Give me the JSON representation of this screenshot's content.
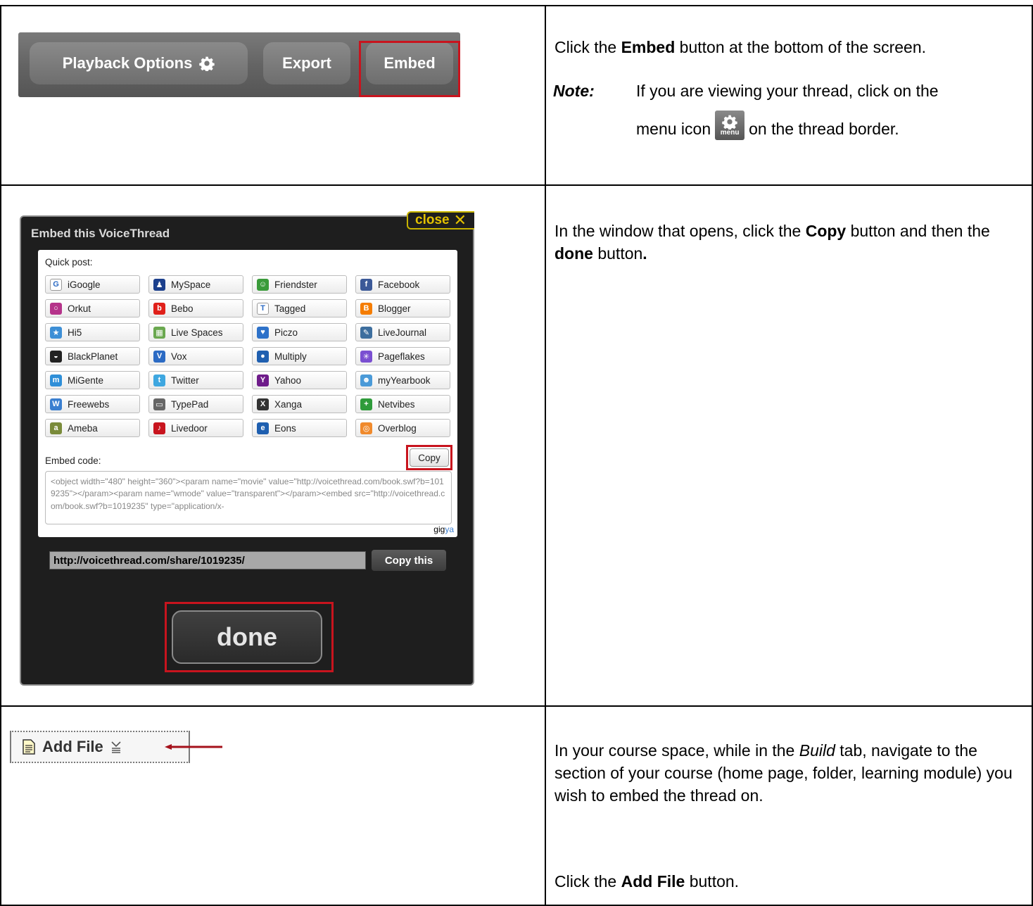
{
  "row1": {
    "toolbar": {
      "playback_label": "Playback Options",
      "export_label": "Export",
      "embed_label": "Embed"
    },
    "instruction": {
      "pre": "Click the ",
      "bold": "Embed",
      "post": " button at the bottom of the screen."
    },
    "note": {
      "label": "Note:",
      "text_pre": "If you are viewing your thread, click on the",
      "text_mid": "menu icon",
      "text_post": "on the thread border.",
      "menu_icon_label": "menu"
    }
  },
  "row2": {
    "dialog": {
      "title": "Embed this VoiceThread",
      "close_label": "close",
      "quick_post_label": "Quick post:",
      "services": [
        {
          "name": "iGoogle",
          "icon": "google-icon",
          "color": "#ffffff"
        },
        {
          "name": "MySpace",
          "icon": "myspace-icon",
          "color": "#1b3f8c"
        },
        {
          "name": "Friendster",
          "icon": "friendster-icon",
          "color": "#3a9b3a"
        },
        {
          "name": "Facebook",
          "icon": "facebook-icon",
          "color": "#3b5998"
        },
        {
          "name": "Orkut",
          "icon": "orkut-icon",
          "color": "#b5338a"
        },
        {
          "name": "Bebo",
          "icon": "bebo-icon",
          "color": "#e0201a"
        },
        {
          "name": "Tagged",
          "icon": "tagged-icon",
          "color": "#ffffff"
        },
        {
          "name": "Blogger",
          "icon": "blogger-icon",
          "color": "#f57d00"
        },
        {
          "name": "Hi5",
          "icon": "hi5-icon",
          "color": "#3d8fd6"
        },
        {
          "name": "Live Spaces",
          "icon": "livespaces-icon",
          "color": "#6aa84f"
        },
        {
          "name": "Piczo",
          "icon": "piczo-icon",
          "color": "#2e72c9"
        },
        {
          "name": "LiveJournal",
          "icon": "livejournal-icon",
          "color": "#3d6e9e"
        },
        {
          "name": "BlackPlanet",
          "icon": "blackplanet-icon",
          "color": "#222222"
        },
        {
          "name": "Vox",
          "icon": "vox-icon",
          "color": "#2c6bc4"
        },
        {
          "name": "Multiply",
          "icon": "multiply-icon",
          "color": "#1f5fb0"
        },
        {
          "name": "Pageflakes",
          "icon": "pageflakes-icon",
          "color": "#7a4fd1"
        },
        {
          "name": "MiGente",
          "icon": "migente-icon",
          "color": "#2f8fd8"
        },
        {
          "name": "Twitter",
          "icon": "twitter-icon",
          "color": "#3ea7e0"
        },
        {
          "name": "Yahoo",
          "icon": "yahoo-icon",
          "color": "#6e1b8a"
        },
        {
          "name": "myYearbook",
          "icon": "myyearbook-icon",
          "color": "#4a9ad8"
        },
        {
          "name": "Freewebs",
          "icon": "freewebs-icon",
          "color": "#3a7fd0"
        },
        {
          "name": "TypePad",
          "icon": "typepad-icon",
          "color": "#666666"
        },
        {
          "name": "Xanga",
          "icon": "xanga-icon",
          "color": "#333333"
        },
        {
          "name": "Netvibes",
          "icon": "netvibes-icon",
          "color": "#2e9b3a"
        },
        {
          "name": "Ameba",
          "icon": "ameba-icon",
          "color": "#7a8b3a"
        },
        {
          "name": "Livedoor",
          "icon": "livedoor-icon",
          "color": "#c8141e"
        },
        {
          "name": "Eons",
          "icon": "eons-icon",
          "color": "#1e5fb0"
        },
        {
          "name": "Overblog",
          "icon": "overblog-icon",
          "color": "#f08a2c"
        }
      ],
      "embed_code_label": "Embed code:",
      "copy_label": "Copy",
      "embed_code": "<object width=\"480\" height=\"360\"><param name=\"movie\" value=\"http://voicethread.com/book.swf?b=1019235\"></param><param name=\"wmode\" value=\"transparent\"></param><embed src=\"http://voicethread.com/book.swf?b=1019235\" type=\"application/x-",
      "gigya_a": "gig",
      "gigya_b": "ya",
      "share_url": "http://voicethread.com/share/1019235/",
      "copy_this_label": "Copy this",
      "done_label": "done"
    },
    "instruction": {
      "t1": "In the window that opens, click the ",
      "b1": "Copy",
      "t2": " button and then the ",
      "b2": "done",
      "t3": " button",
      "b3": "."
    }
  },
  "row3": {
    "add_file_label": "Add File",
    "instruction1": {
      "t1": "In your course space, while in the ",
      "i1": "Build",
      "t2": " tab, navigate to the section of your course (home page, folder, learning module)  you wish to embed the thread on."
    },
    "instruction2": {
      "t1": "Click the ",
      "b1": "Add File",
      "t2": " button."
    }
  },
  "colors": {
    "highlight_red": "#c8141e",
    "arrow_red": "#a5111b",
    "close_yellow": "#e3c100"
  }
}
